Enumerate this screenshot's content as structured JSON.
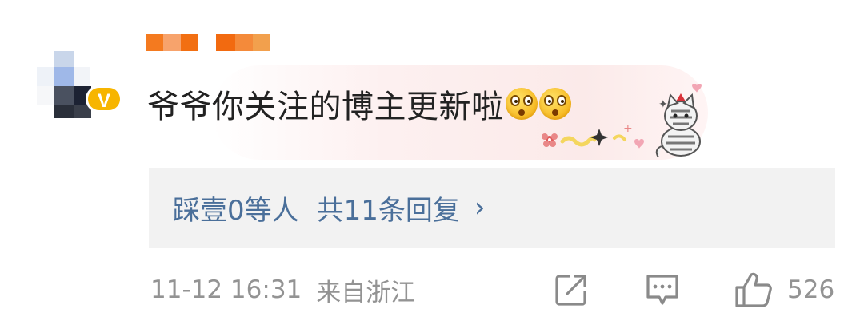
{
  "comment": {
    "text": "爷爷你关注的博主更新啦",
    "emojis": [
      "flushed-face-icon",
      "flushed-face-icon"
    ],
    "sticker": "cat-sticker-icon"
  },
  "badge": {
    "label": "V",
    "color": "#f7b500"
  },
  "replies": {
    "users": "踩壹0等人",
    "count_label": "共11条回复",
    "chevron": "›",
    "color": "#4a6f9a"
  },
  "footer": {
    "time": "11-12 16:31",
    "location": "来自浙江",
    "like_count": "526",
    "actions": [
      "share-icon",
      "comment-icon",
      "like-icon"
    ]
  },
  "colors": {
    "nickname_mosaic": "#f47a1f",
    "meta_text": "#939393",
    "text": "#222222"
  }
}
